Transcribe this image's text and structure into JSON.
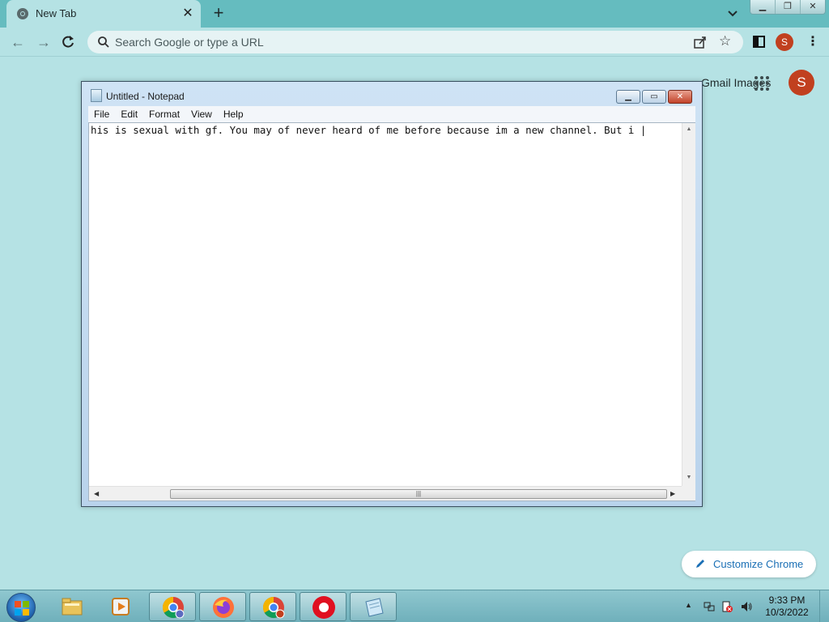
{
  "browser": {
    "tab_title": "New Tab",
    "omnibox_placeholder": "Search Google or type a URL",
    "profile_initial": "S",
    "top_links": "Gmail  Images",
    "customize_label": "Customize Chrome"
  },
  "notepad": {
    "title": "Untitled - Notepad",
    "menu": [
      "File",
      "Edit",
      "Format",
      "View",
      "Help"
    ],
    "content": "his is sexual with gf. You may of never heard of me before because im a new channel. But i |"
  },
  "taskbar": {
    "items": [
      "ie-icon",
      "folder-icon",
      "media-player-icon",
      "chrome-icon",
      "firefox-icon",
      "chrome-profile-icon",
      "record-icon",
      "notepad-icon"
    ],
    "time": "9:33 PM",
    "date": "10/3/2022"
  },
  "colors": {
    "theme": "#b5e2e4",
    "tabstrip": "#65bcbf",
    "profile": "#c1401f",
    "customize_text": "#1a6fb5"
  }
}
